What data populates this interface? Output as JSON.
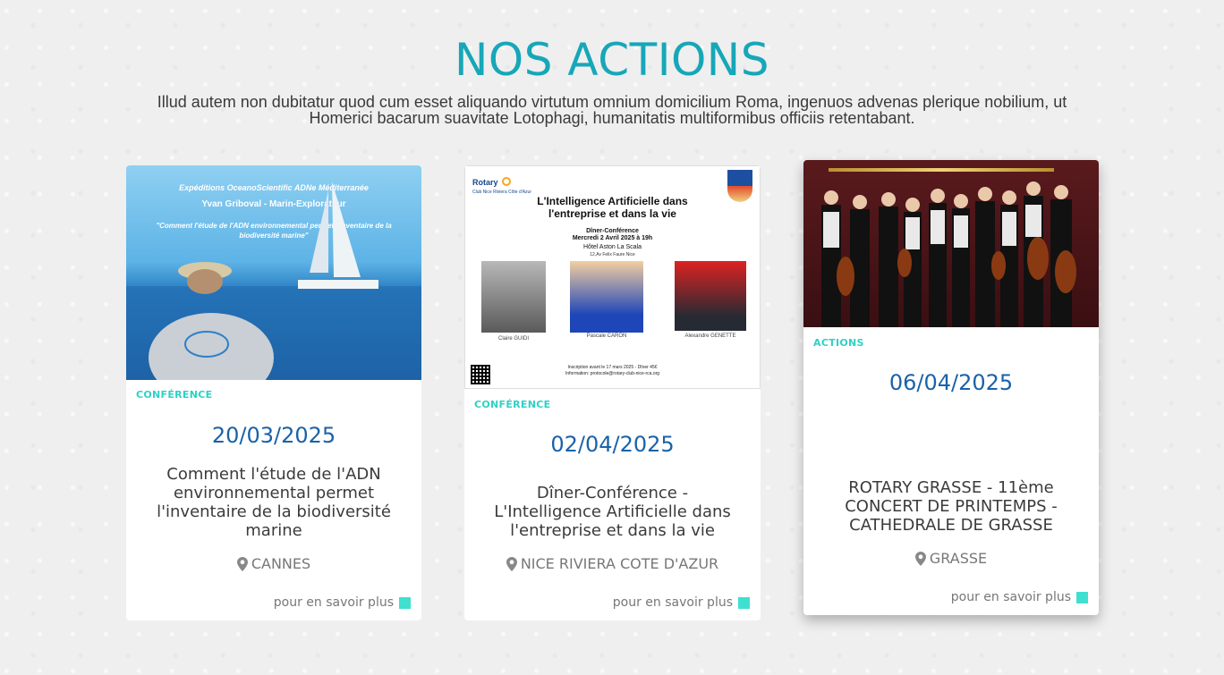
{
  "section": {
    "title": "NOS ACTIONS",
    "intro": "Illud autem non dubitatur quod cum esset aliquando virtutum omnium domicilium Roma, ingenuos advenas plerique nobilium, ut Homerici bacarum suavitate Lotophagi, humanitatis multiformibus officiis retentabant."
  },
  "cards": [
    {
      "category": "CONFÉRENCE",
      "date": "20/03/2025",
      "title": "Comment l'étude de l'ADN environnemental permet l'inventaire de la biodiversité marine",
      "location": "CANNES",
      "more": "pour en savoir plus",
      "image": {
        "line1": "Expéditions OceanoScientific ADNe Méditerranée",
        "line2": "Yvan Griboval - Marin-Explorateur",
        "line3": "\"Comment l'étude de l'ADN environnemental permet l'inventaire de la biodiversité marine\""
      }
    },
    {
      "category": "CONFÉRENCE",
      "date": "02/04/2025",
      "title": "Dîner-Conférence - L'Intelligence Artificielle dans l'entreprise et dans la vie",
      "location": "NICE RIVIERA COTE D'AZUR",
      "more": "pour en savoir plus",
      "image": {
        "club": "Rotary",
        "club_sub": "Club Nice Riviera Côte d'Azur",
        "headline": "L'Intelligence Artificielle dans l'entreprise et dans la vie",
        "event": "Dîner-Conférence",
        "when": "Mercredi 2 Avril 2025 à 19h",
        "venue": "Hôtel Aston La Scala",
        "address": "12,Av Felix Faure Nice",
        "speakers": [
          "Claire GUIDI",
          "Pascale CARON",
          "Alexandre GENETTE"
        ],
        "inscription": "Inscription avant le 17 mars 2025 - Dîner 45€",
        "info": "Information: protocole@rotary-club-nice-rca.org"
      }
    },
    {
      "category": "ACTIONS",
      "date": "06/04/2025",
      "title": "ROTARY GRASSE - 11ème CONCERT DE PRINTEMPS - CATHEDRALE DE GRASSE",
      "location": "GRASSE",
      "more": "pour en savoir plus"
    }
  ],
  "colors": {
    "title": "#16a7b8",
    "category": "#2ed1c6",
    "date": "#1a62a8",
    "accent_square": "#3fe0cf"
  },
  "icons": {
    "location": "map-pin-icon"
  }
}
